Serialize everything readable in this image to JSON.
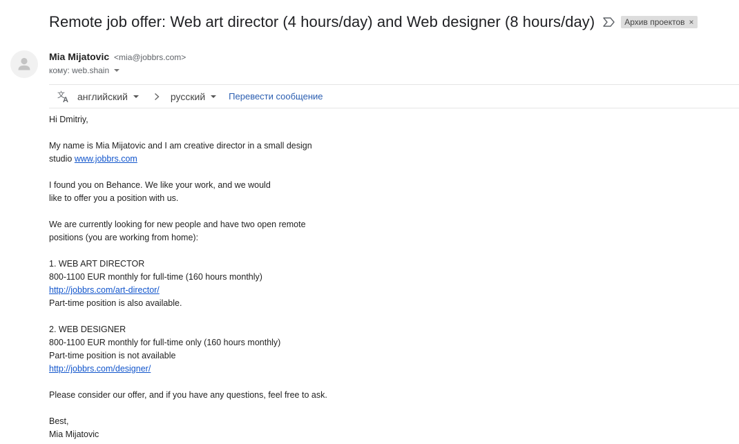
{
  "email": {
    "subject": "Remote job offer: Web art director (4 hours/day) and Web designer (8 hours/day)",
    "label": "Архив проектов",
    "label_remove": "×"
  },
  "sender": {
    "name": "Mia Mijatovic",
    "email": "<mia@jobbrs.com>",
    "to_line": "кому: web.shain"
  },
  "translate": {
    "source_lang": "английский",
    "target_lang": "русский",
    "action": "Перевести сообщение"
  },
  "body": {
    "greeting": "Hi Dmitriy,",
    "intro_1": "My name is Mia Mijatovic and I am creative director in a small design",
    "intro_2": "studio ",
    "intro_link": "www.jobbrs.com",
    "found_1": "I found you on Behance. We like your work, and we would",
    "found_2": "like to offer you a position with us.",
    "looking_1": "We are currently looking for new people and have two open remote",
    "looking_2": "positions (you are working from home):",
    "pos1_title": "1. WEB ART DIRECTOR",
    "pos1_pay": "800-1100 EUR monthly for full-time (160 hours monthly)",
    "pos1_link": "http://jobbrs.com/art-director/",
    "pos1_note": "Part-time position is also available.",
    "pos2_title": "2. WEB DESIGNER",
    "pos2_pay": "800-1100 EUR monthly for full-time only (160 hours monthly)",
    "pos2_note": "Part-time position is not available",
    "pos2_link": "http://jobbrs.com/designer/",
    "closing": "Please consider our offer, and if you have any questions, feel free to ask.",
    "signoff": "Best,",
    "signature": "Mia Mijatovic"
  },
  "icons": {
    "important": "important-marker-icon",
    "avatar": "person-icon",
    "translate": "translate-icon",
    "arrow": "chevron-right-icon"
  },
  "colors": {
    "link": "#1155cc",
    "translate_link": "#2a5db0",
    "label_bg": "#dddddd"
  }
}
